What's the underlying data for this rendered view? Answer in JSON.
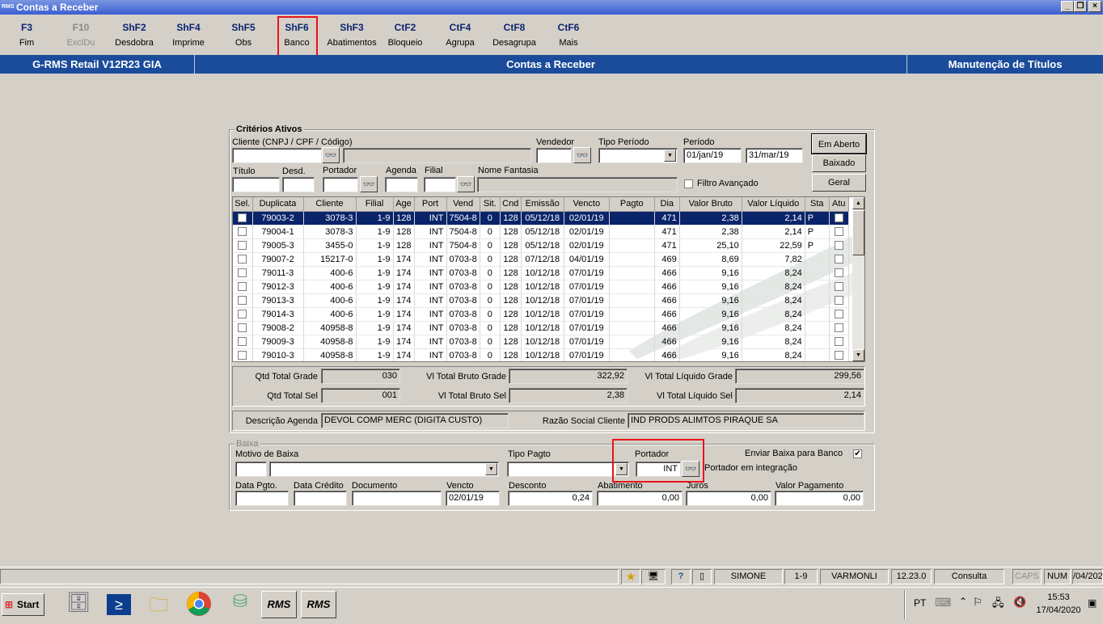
{
  "window": {
    "title": "Contas a Receber",
    "app_icon": "RMS"
  },
  "toolbar": [
    {
      "key": "F3",
      "label": "Fim"
    },
    {
      "key": "F10",
      "label": "ExclDu"
    },
    {
      "key": "ShF2",
      "label": "Desdobra"
    },
    {
      "key": "ShF4",
      "label": "Imprime"
    },
    {
      "key": "ShF5",
      "label": "Obs"
    },
    {
      "key": "ShF6",
      "label": "Banco"
    },
    {
      "key": "ShF3",
      "label": "Abatimentos"
    },
    {
      "key": "CtF2",
      "label": "Bloqueio"
    },
    {
      "key": "CtF4",
      "label": "Agrupa"
    },
    {
      "key": "CtF8",
      "label": "Desagrupa"
    },
    {
      "key": "CtF6",
      "label": "Mais"
    }
  ],
  "header": {
    "left": "G-RMS Retail V12R23 GIA",
    "center": "Contas a Receber",
    "right": "Manutenção de Títulos"
  },
  "criterios": {
    "legend": "Critérios Ativos",
    "cliente_label": "Cliente (CNPJ / CPF / Código)",
    "vendedor_label": "Vendedor",
    "tipo_periodo_label": "Tipo Período",
    "periodo_label": "Período",
    "periodo_de": "01/jan/19",
    "periodo_ate": "31/mar/19",
    "titulo_label": "Título",
    "desd_label": "Desd.",
    "portador_label": "Portador",
    "agenda_label": "Agenda",
    "filial_label": "Filial",
    "nome_fantasia_label": "Nome Fantasia",
    "filtro_avancado_label": "Filtro Avançado",
    "btn_em_aberto": "Em Aberto",
    "btn_baixado": "Baixado",
    "btn_geral": "Geral"
  },
  "grid": {
    "columns": [
      "Sel.",
      "Duplicata",
      "Cliente",
      "Filial",
      "Age",
      "Port",
      "Vend",
      "Sit.",
      "Cnd",
      "Emissão",
      "Vencto",
      "Pagto",
      "Dia",
      "Valor Bruto",
      "Valor Líquido",
      "Sta",
      "Atu"
    ],
    "rows": [
      [
        "79003-2",
        "3078-3",
        "1-9",
        "128",
        "INT",
        "7504-8",
        "0",
        "128",
        "05/12/18",
        "02/01/19",
        "",
        "471",
        "2,38",
        "2,14",
        "P"
      ],
      [
        "79004-1",
        "3078-3",
        "1-9",
        "128",
        "INT",
        "7504-8",
        "0",
        "128",
        "05/12/18",
        "02/01/19",
        "",
        "471",
        "2,38",
        "2,14",
        "P"
      ],
      [
        "79005-3",
        "3455-0",
        "1-9",
        "128",
        "INT",
        "7504-8",
        "0",
        "128",
        "05/12/18",
        "02/01/19",
        "",
        "471",
        "25,10",
        "22,59",
        "P"
      ],
      [
        "79007-2",
        "15217-0",
        "1-9",
        "174",
        "INT",
        "0703-8",
        "0",
        "128",
        "07/12/18",
        "04/01/19",
        "",
        "469",
        "8,69",
        "7,82",
        ""
      ],
      [
        "79011-3",
        "400-6",
        "1-9",
        "174",
        "INT",
        "0703-8",
        "0",
        "128",
        "10/12/18",
        "07/01/19",
        "",
        "466",
        "9,16",
        "8,24",
        ""
      ],
      [
        "79012-3",
        "400-6",
        "1-9",
        "174",
        "INT",
        "0703-8",
        "0",
        "128",
        "10/12/18",
        "07/01/19",
        "",
        "466",
        "9,16",
        "8,24",
        ""
      ],
      [
        "79013-3",
        "400-6",
        "1-9",
        "174",
        "INT",
        "0703-8",
        "0",
        "128",
        "10/12/18",
        "07/01/19",
        "",
        "466",
        "9,16",
        "8,24",
        ""
      ],
      [
        "79014-3",
        "400-6",
        "1-9",
        "174",
        "INT",
        "0703-8",
        "0",
        "128",
        "10/12/18",
        "07/01/19",
        "",
        "466",
        "9,16",
        "8,24",
        ""
      ],
      [
        "79008-2",
        "40958-8",
        "1-9",
        "174",
        "INT",
        "0703-8",
        "0",
        "128",
        "10/12/18",
        "07/01/19",
        "",
        "466",
        "9,16",
        "8,24",
        ""
      ],
      [
        "79009-3",
        "40958-8",
        "1-9",
        "174",
        "INT",
        "0703-8",
        "0",
        "128",
        "10/12/18",
        "07/01/19",
        "",
        "466",
        "9,16",
        "8,24",
        ""
      ],
      [
        "79010-3",
        "40958-8",
        "1-9",
        "174",
        "INT",
        "0703-8",
        "0",
        "128",
        "10/12/18",
        "07/01/19",
        "",
        "466",
        "9,16",
        "8,24",
        ""
      ]
    ],
    "selected_row": 0
  },
  "totals": {
    "qtd_total_grade_label": "Qtd Total Grade",
    "qtd_total_grade": "030",
    "vl_total_bruto_grade_label": "Vl Total Bruto Grade",
    "vl_total_bruto_grade": "322,92",
    "vl_total_liquido_grade_label": "Vl Total Líquido Grade",
    "vl_total_liquido_grade": "299,56",
    "qtd_total_sel_label": "Qtd Total Sel",
    "qtd_total_sel": "001",
    "vl_total_bruto_sel_label": "Vl Total Bruto Sel",
    "vl_total_bruto_sel": "2,38",
    "vl_total_liquido_sel_label": "Vl Total Líquido Sel",
    "vl_total_liquido_sel": "2,14"
  },
  "descricao": {
    "agenda_label": "Descrição Agenda",
    "agenda_value": "DEVOL COMP MERC (DIGITA CUSTO)",
    "razao_label": "Razão Social Cliente",
    "razao_value": "IND PRODS ALIMTOS PIRAQUE SA"
  },
  "baixa": {
    "legend": "Baixa",
    "motivo_label": "Motivo de Baixa",
    "tipo_pagto_label": "Tipo Pagto",
    "portador_label": "Portador",
    "portador_value": "INT",
    "portador_desc": "Portador em integração",
    "enviar_label": "Enviar Baixa para Banco",
    "data_pgto_label": "Data Pgto.",
    "data_credito_label": "Data Crédito",
    "documento_label": "Documento",
    "vencto_label": "Vencto",
    "vencto_value": "02/01/19",
    "desconto_label": "Desconto",
    "desconto_value": "0,24",
    "abatimento_label": "Abatimento",
    "abatimento_value": "0,00",
    "juros_label": "Juros",
    "juros_value": "0,00",
    "valor_pagamento_label": "Valor Pagamento",
    "valor_pagamento_value": "0,00"
  },
  "statusbar": {
    "user": "SIMONE",
    "filial": "1-9",
    "host": "VARMONLI",
    "version": "12.23.0",
    "mode": "Consulta",
    "caps": "CAPS",
    "num": "NUM",
    "date": "/04/202"
  },
  "taskbar": {
    "start": "Start",
    "rms1": "RMS",
    "rms2": "RMS",
    "lang": "PT",
    "time": "15:53",
    "date": "17/04/2020"
  }
}
